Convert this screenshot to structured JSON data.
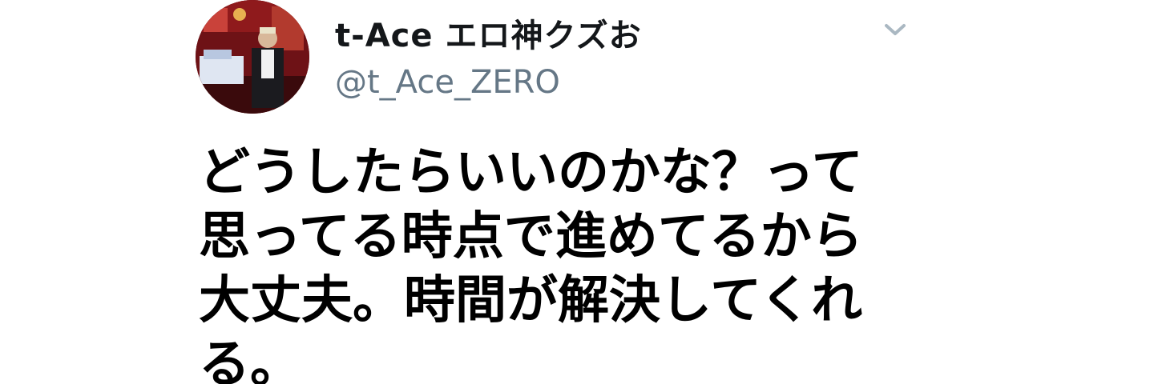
{
  "tweet": {
    "author": {
      "display_name": "t-Ace エロ神クズお",
      "handle": "@t_Ace_ZERO",
      "avatar_icon": "user-avatar-photo"
    },
    "menu_icon": "chevron-down-icon",
    "text": "どうしたらいいのかな？って思ってる時点で進めてるから大丈夫。時間が解決してくれる。"
  },
  "colors": {
    "name": "#14171a",
    "handle": "#657786",
    "text": "#000000",
    "caret": "#aab8c2",
    "background": "#ffffff"
  }
}
